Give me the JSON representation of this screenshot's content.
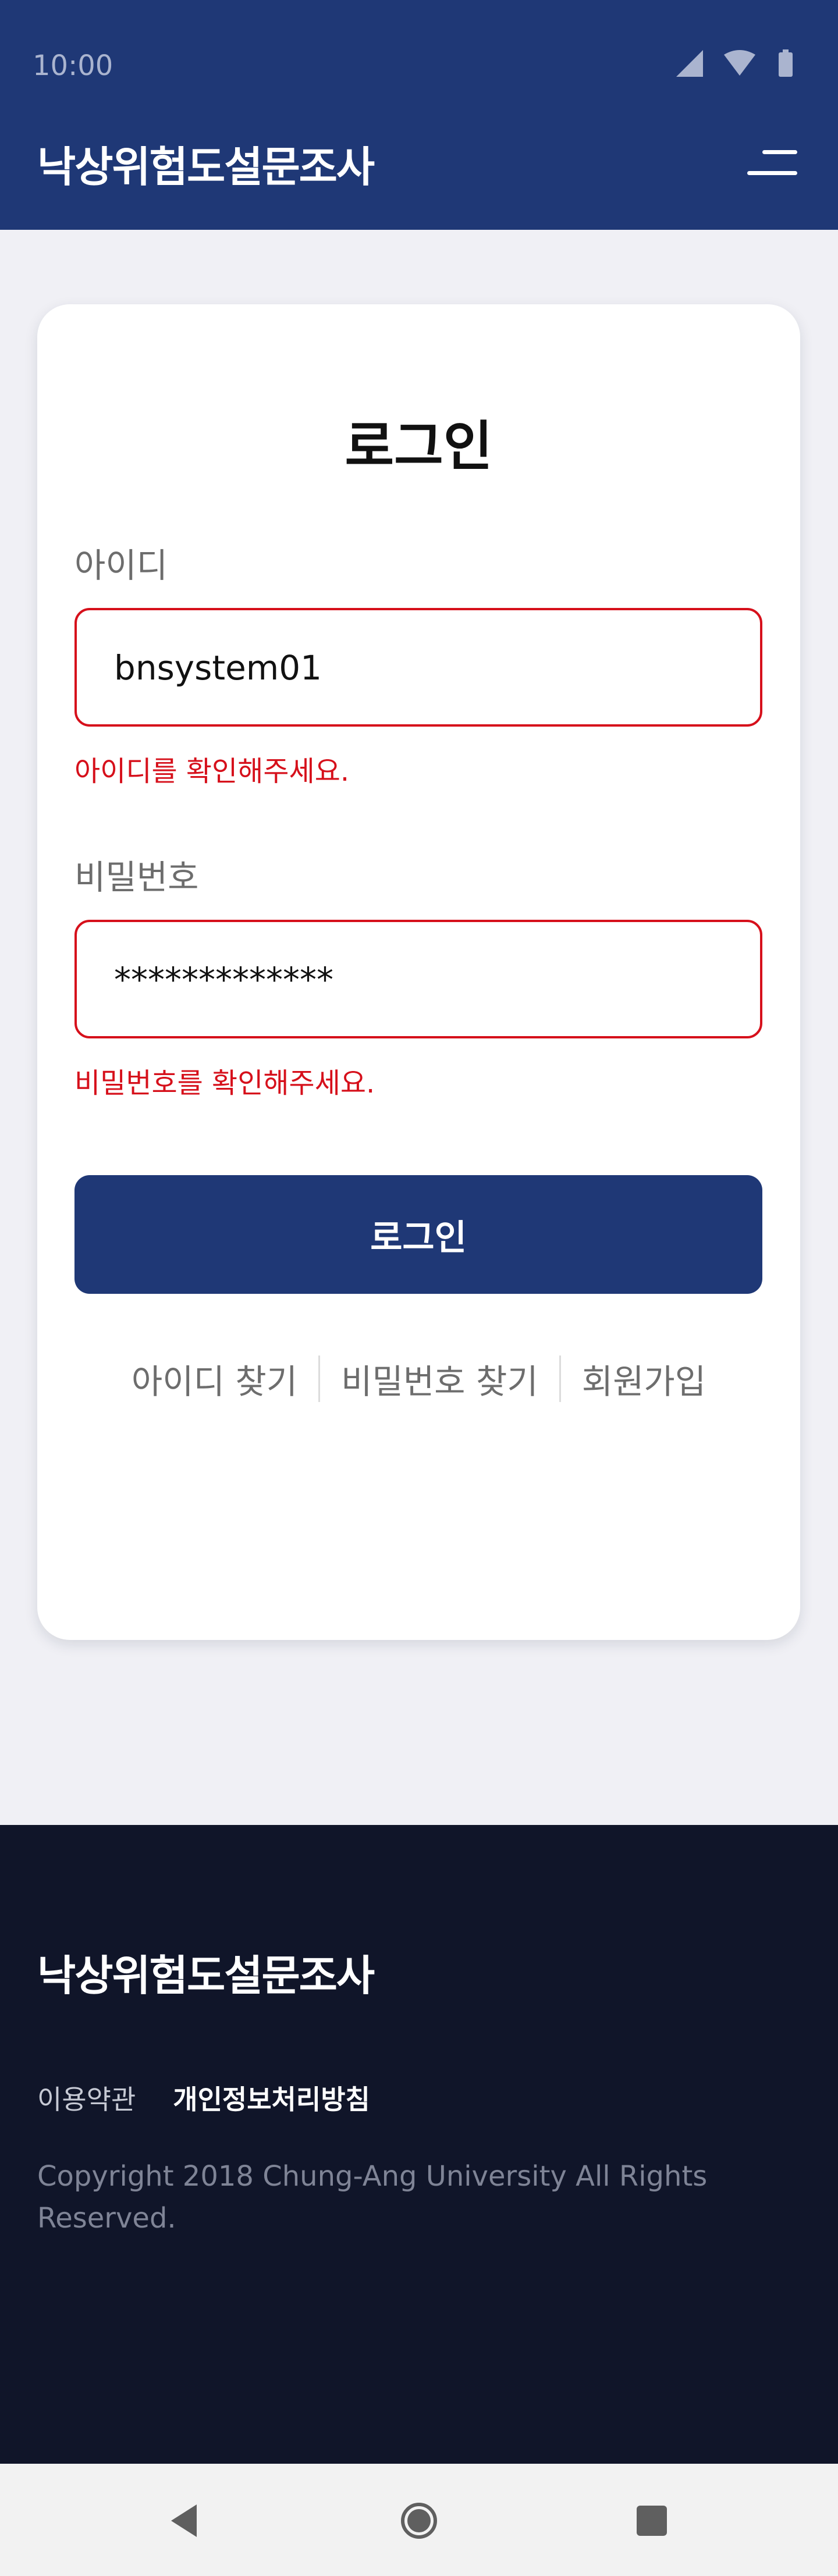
{
  "status_bar": {
    "time": "10:00"
  },
  "header": {
    "app_title": "낙상위험도설문조사"
  },
  "login": {
    "title": "로그인",
    "id_label": "아이디",
    "id_value": "bnsystem01",
    "id_error": "아이디를 확인해주세요.",
    "password_label": "비밀번호",
    "password_value": "*************",
    "password_error": "비밀번호를 확인해주세요.",
    "submit_label": "로그인",
    "links": {
      "find_id": "아이디 찾기",
      "find_password": "비밀번호 찾기",
      "signup": "회원가입"
    }
  },
  "footer": {
    "title": "낙상위험도설문조사",
    "terms": "이용약관",
    "privacy": "개인정보처리방침",
    "copyright": "Copyright 2018 Chung-Ang University All Rights Reserved."
  },
  "icons": {
    "signal": "signal-icon",
    "wifi": "wifi-icon",
    "battery": "battery-icon",
    "menu": "menu-icon",
    "back": "back-icon",
    "home": "home-icon",
    "recents": "recents-icon"
  },
  "colors": {
    "brand": "#1f3876",
    "error": "#d6101b",
    "footer_bg": "#101529",
    "page_bg": "#f0f0f5"
  }
}
